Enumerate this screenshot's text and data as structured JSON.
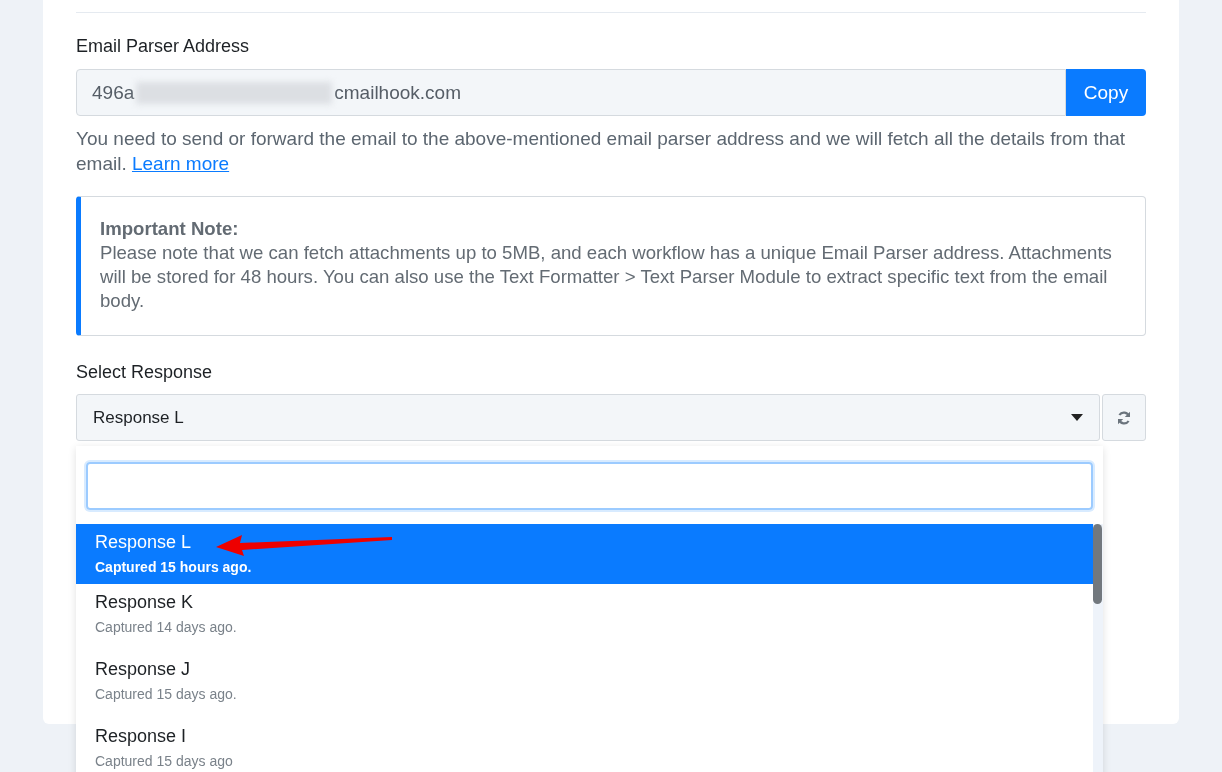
{
  "email_parser": {
    "label": "Email Parser Address",
    "address_start": "496a",
    "address_end": "cmailhook.com",
    "copy_button": "Copy",
    "help_text": "You need to send or forward the email to the above-mentioned email parser address and we will fetch all the details from that email.",
    "help_link": "Learn more"
  },
  "note": {
    "title": "Important Note:",
    "body": "Please note that we can fetch attachments up to 5MB, and each workflow has a unique Email Parser address. Attachments will be stored for 48 hours. You can also use the Text Formatter > Text Parser Module to extract specific text from the email body."
  },
  "select_response": {
    "label": "Select Response",
    "value": "Response L",
    "expanded": true
  },
  "options": [
    {
      "name": "Response L",
      "captured": "Captured 15 hours ago.",
      "selected": true
    },
    {
      "name": "Response K",
      "captured": "Captured 14 days ago.",
      "selected": false
    },
    {
      "name": "Response J",
      "captured": "Captured 15 days ago.",
      "selected": false
    },
    {
      "name": "Response I",
      "captured": "Captured 15 days ago",
      "selected": false
    }
  ]
}
